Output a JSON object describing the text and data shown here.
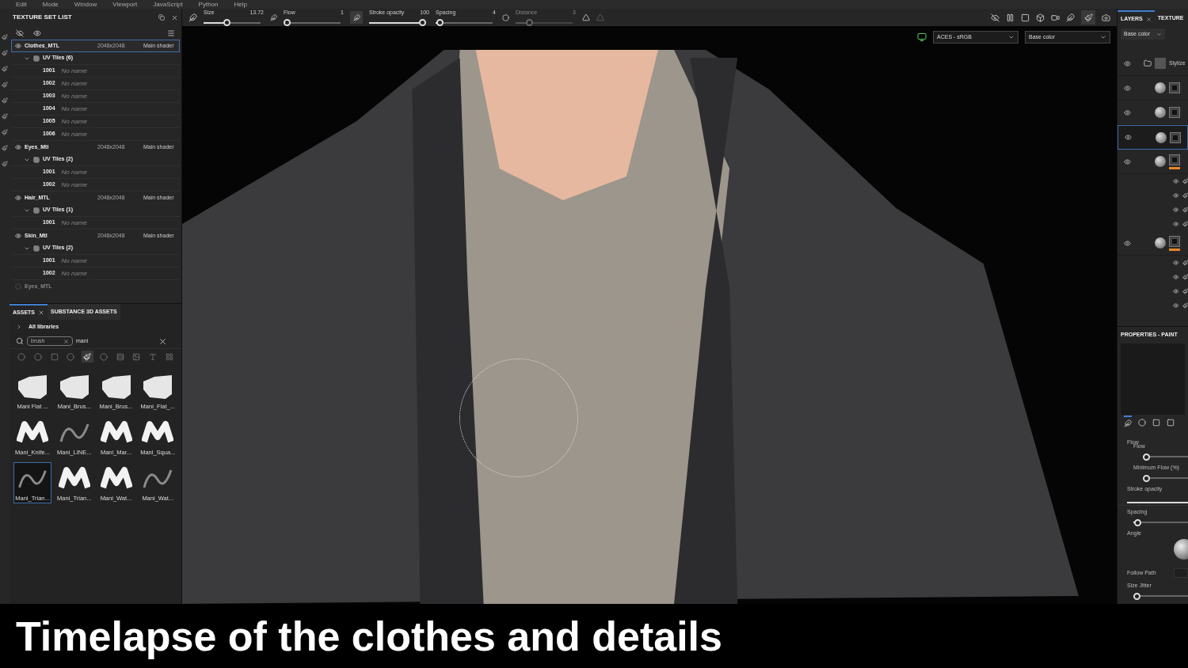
{
  "menu": [
    "Edit",
    "Mode",
    "Window",
    "Viewport",
    "JavaScript",
    "Python",
    "Help"
  ],
  "toolbar": {
    "sliders": [
      {
        "label": "Size",
        "value": "13.72",
        "level": 0.4,
        "disabled": false
      },
      {
        "label": "Flow",
        "value": "1",
        "level": 0,
        "disabled": false
      },
      {
        "label": "Stroke opacity",
        "value": "100",
        "level": 1,
        "disabled": false
      },
      {
        "label": "Spacing",
        "value": "4",
        "level": 0.02,
        "disabled": false
      },
      {
        "label": "Distance",
        "value": "3",
        "level": 0.2,
        "disabled": true
      }
    ]
  },
  "texture_set_list": {
    "title": "TEXTURE SET LIST",
    "sets": [
      {
        "name": "Clothes_MTL",
        "resolution": "2048x2048",
        "shader": "Main shader",
        "enabled": true,
        "selected": true,
        "uv_tiles": {
          "label": "UV Tiles (6)",
          "expanded": true,
          "tiles": [
            {
              "id": "1001",
              "name": "No name"
            },
            {
              "id": "1002",
              "name": "No name"
            },
            {
              "id": "1003",
              "name": "No name"
            },
            {
              "id": "1004",
              "name": "No name"
            },
            {
              "id": "1005",
              "name": "No name"
            },
            {
              "id": "1006",
              "name": "No name"
            }
          ]
        }
      },
      {
        "name": "Eyes_Mtl",
        "resolution": "2048x2048",
        "shader": "Main shader",
        "enabled": true,
        "selected": false,
        "uv_tiles": {
          "label": "UV Tiles (2)",
          "expanded": true,
          "tiles": [
            {
              "id": "1001",
              "name": "No name"
            },
            {
              "id": "1002",
              "name": "No name"
            }
          ]
        }
      },
      {
        "name": "Hair_MTL",
        "resolution": "2048x2048",
        "shader": "Main shader",
        "enabled": true,
        "selected": false,
        "uv_tiles": {
          "label": "UV Tiles (1)",
          "expanded": true,
          "tiles": [
            {
              "id": "1001",
              "name": "No name"
            }
          ]
        }
      },
      {
        "name": "Skin_Mtl",
        "resolution": "2048x2048",
        "shader": "Main shader",
        "enabled": true,
        "selected": false,
        "uv_tiles": {
          "label": "UV Tiles (2)",
          "expanded": true,
          "tiles": [
            {
              "id": "1001",
              "name": "No name"
            },
            {
              "id": "1002",
              "name": "No name"
            }
          ]
        }
      },
      {
        "name": "Eyes_MTL",
        "enabled": false,
        "selected": false
      }
    ]
  },
  "assets": {
    "tabs": [
      {
        "label": "ASSETS",
        "selected": true
      },
      {
        "label": "SUBSTANCE 3D ASSETS",
        "selected": false
      }
    ],
    "library": "All libraries",
    "filter": "brush",
    "query": "mani",
    "filters": [
      {
        "selected": false
      },
      {
        "selected": false
      },
      {
        "selected": false
      },
      {
        "selected": false
      },
      {
        "selected": true
      },
      {
        "selected": false
      },
      {
        "selected": false
      },
      {
        "selected": false
      },
      {
        "selected": false
      },
      {
        "selected": false
      }
    ],
    "brushes": [
      {
        "label": "Mani Flat ...",
        "kind": "flat",
        "selected": false
      },
      {
        "label": "Mani_Brus...",
        "kind": "flat",
        "selected": false
      },
      {
        "label": "Mani_Brus...",
        "kind": "flat",
        "selected": false
      },
      {
        "label": "Mani_Flat_...",
        "kind": "flat",
        "selected": false
      },
      {
        "label": "Mani_Knife...",
        "kind": "wave",
        "selected": false
      },
      {
        "label": "Mani_LINE...",
        "kind": "line",
        "selected": false
      },
      {
        "label": "Mani_Mar...",
        "kind": "wave",
        "selected": false
      },
      {
        "label": "Mani_Squa...",
        "kind": "wave",
        "selected": false
      },
      {
        "label": "Mani_Trian...",
        "kind": "line",
        "selected": true
      },
      {
        "label": "Mani_Trian...",
        "kind": "wave",
        "selected": false
      },
      {
        "label": "Mani_Wat...",
        "kind": "wave",
        "selected": false
      },
      {
        "label": "Mani_Wat...",
        "kind": "line",
        "selected": false
      }
    ]
  },
  "viewport": {
    "color_profile": "ACES - sRGB",
    "channel": "Base color"
  },
  "layers": {
    "tabs": [
      {
        "label": "LAYERS",
        "selected": true
      },
      {
        "label": "TEXTURE",
        "selected": false
      }
    ],
    "channel": "Base color",
    "items": [
      {
        "kind": "folder",
        "name": "Stylize",
        "selected": false
      },
      {
        "kind": "fill",
        "selected": false
      },
      {
        "kind": "fill",
        "selected": false
      },
      {
        "kind": "fill",
        "selected": true
      },
      {
        "kind": "fill",
        "selected": false,
        "color": "#e8862a",
        "children": [
          {
            "kind": "paint"
          },
          {
            "kind": "paint"
          },
          {
            "kind": "paint"
          },
          {
            "kind": "paint"
          }
        ]
      },
      {
        "kind": "fill",
        "selected": false,
        "color": "#e8862a",
        "children": [
          {
            "kind": "paint"
          },
          {
            "kind": "paint"
          },
          {
            "kind": "paint"
          },
          {
            "kind": "paint"
          }
        ]
      }
    ]
  },
  "properties": {
    "title": "PROPERTIES - PAINT",
    "tabs": [
      {
        "selected": true
      },
      {
        "selected": false
      },
      {
        "selected": false
      },
      {
        "selected": false
      }
    ],
    "params": [
      {
        "kind": "section",
        "label": "Flow"
      },
      {
        "kind": "slider",
        "label": "Flow",
        "level": 0,
        "indent": true
      },
      {
        "kind": "slider",
        "label": "Minimum Flow (%)",
        "level": 0,
        "indent": true
      },
      {
        "kind": "bar",
        "label": "Stroke opacity",
        "level": 1
      },
      {
        "kind": "slider",
        "label": "Spacing",
        "level": 0.02
      },
      {
        "kind": "knob",
        "label": "Angle"
      },
      {
        "kind": "toggle",
        "label": "Follow Path"
      },
      {
        "kind": "slider",
        "label": "Size Jitter",
        "level": 0
      }
    ]
  },
  "caption": "Timelapse of the clothes and details"
}
